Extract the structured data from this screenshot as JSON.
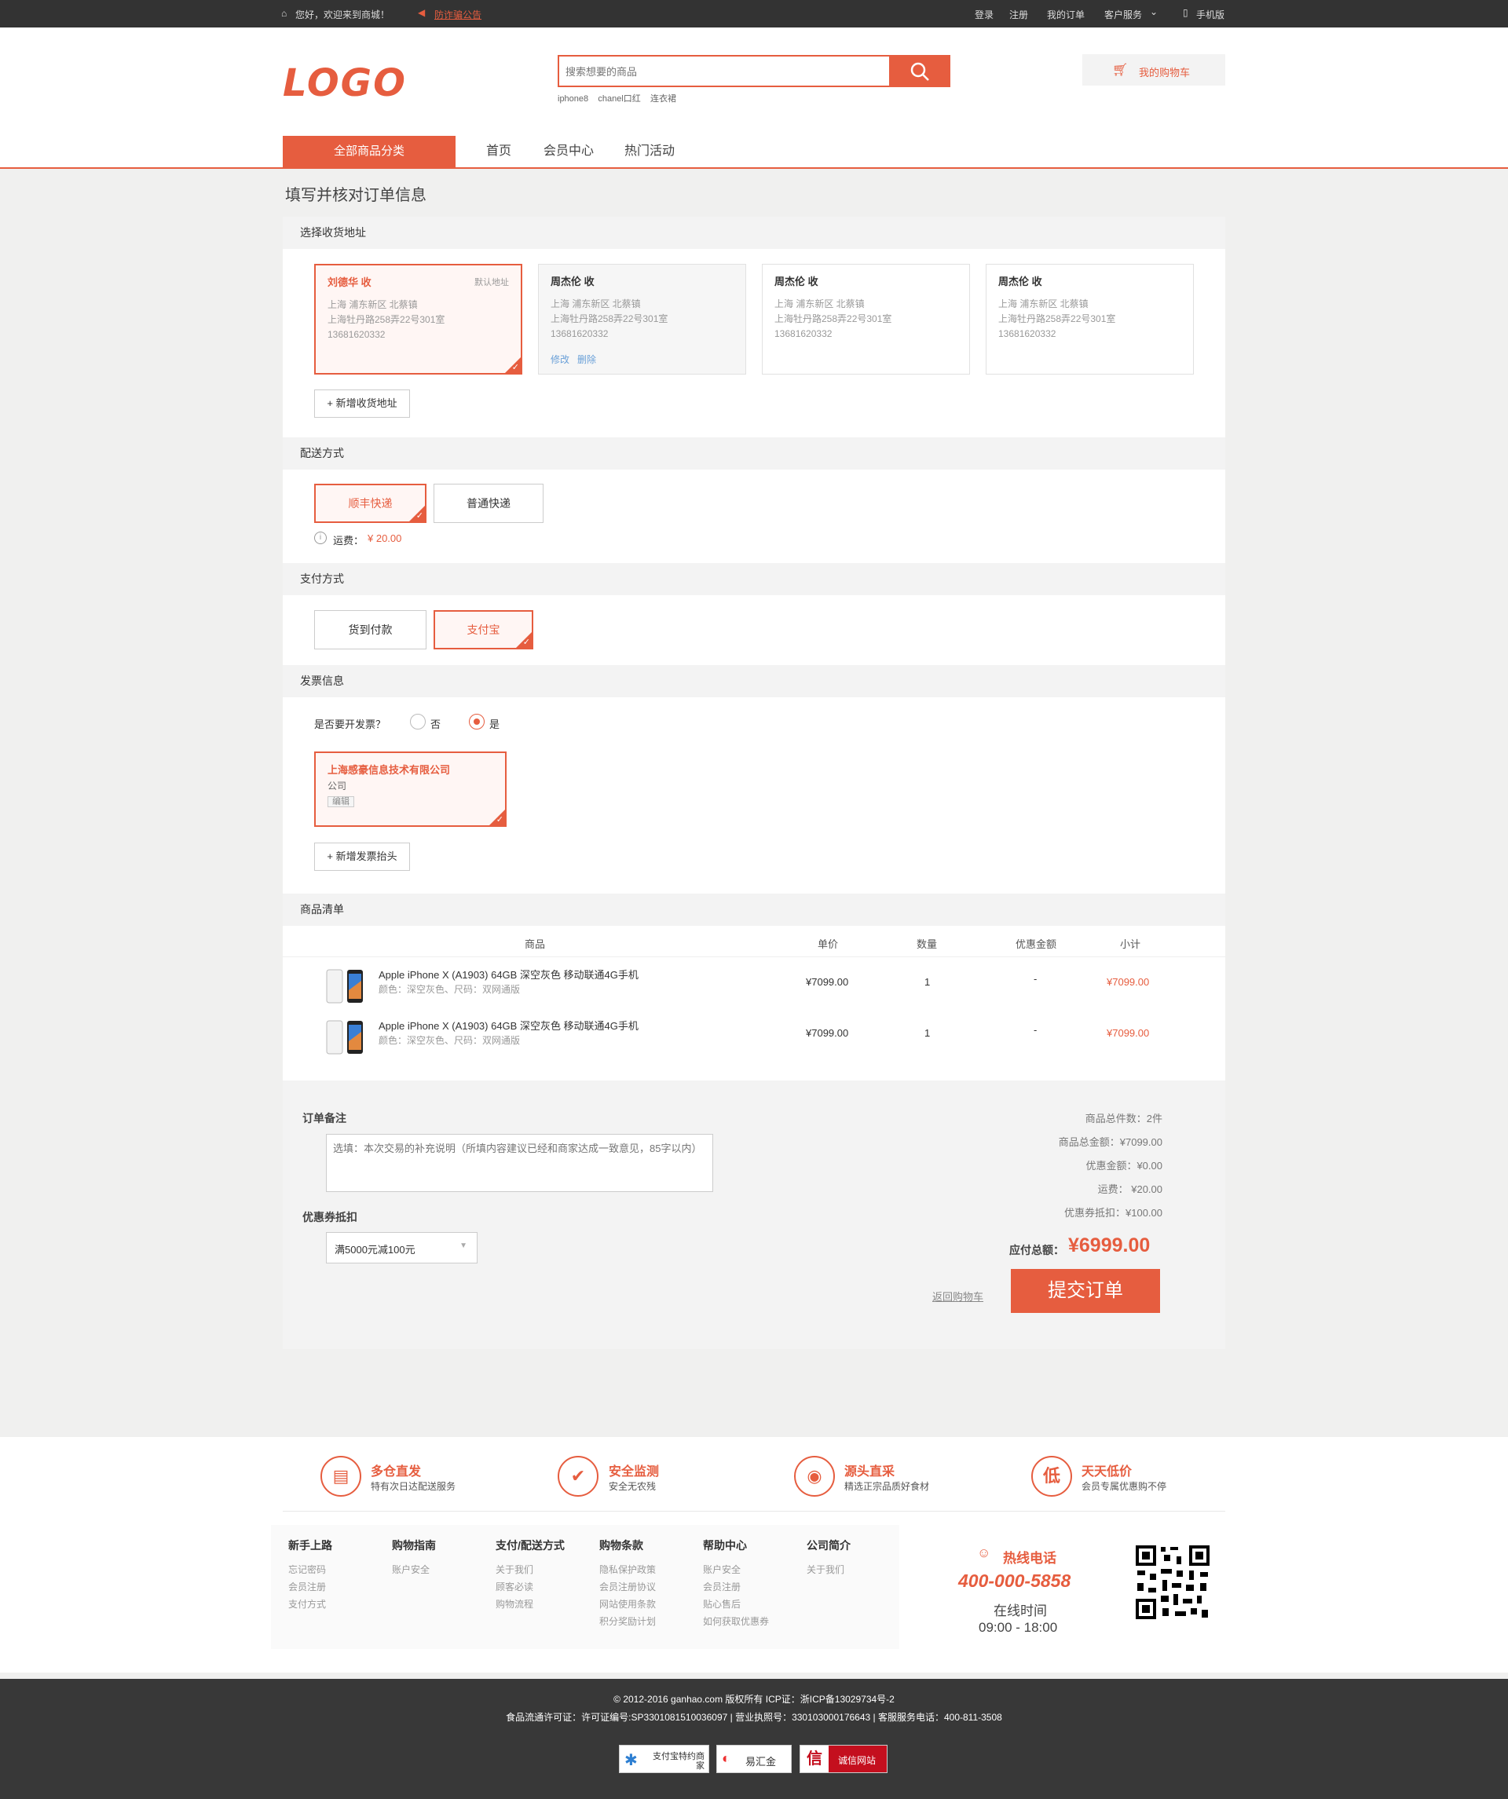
{
  "topbar": {
    "welcome": "您好，欢迎来到商城！",
    "notice": "防诈骗公告",
    "login": "登录",
    "register": "注册",
    "my_orders": "我的订单",
    "service": "客户服务",
    "mobile": "手机版"
  },
  "header": {
    "logo": "LOGO",
    "search_placeholder": "搜索想要的商品",
    "hot": [
      "iphone8",
      "chanel口红",
      "连衣裙"
    ],
    "cart": "我的购物车"
  },
  "nav": {
    "category": "全部商品分类",
    "links": [
      "首页",
      "会员中心",
      "热门活动"
    ]
  },
  "page_title": "填写并核对订单信息",
  "address": {
    "title": "选择收货地址",
    "cards": [
      {
        "name": "刘德华 收",
        "default": "默认地址",
        "line1": "上海 浦东新区 北蔡镇",
        "line2": "上海牡丹路258弄22号301室",
        "phone": "13681620332"
      },
      {
        "name": "周杰伦 收",
        "line1": "上海 浦东新区 北蔡镇",
        "line2": "上海牡丹路258弄22号301室",
        "phone": "13681620332",
        "edit": "修改",
        "delete": "删除"
      },
      {
        "name": "周杰伦 收",
        "line1": "上海 浦东新区 北蔡镇",
        "line2": "上海牡丹路258弄22号301室",
        "phone": "13681620332"
      },
      {
        "name": "周杰伦 收",
        "line1": "上海 浦东新区 北蔡镇",
        "line2": "上海牡丹路258弄22号301室",
        "phone": "13681620332"
      }
    ],
    "add": "+ 新增收货地址"
  },
  "shipping": {
    "title": "配送方式",
    "options": [
      "顺丰快递",
      "普通快递"
    ],
    "fee_label": "运费：",
    "fee": "¥ 20.00"
  },
  "payment": {
    "title": "支付方式",
    "options": [
      "货到付款",
      "支付宝"
    ]
  },
  "invoice": {
    "title": "发票信息",
    "question": "是否要开发票？",
    "no": "否",
    "yes": "是",
    "company": "上海感豪信息技术有限公司",
    "type": "公司",
    "edit": "编辑",
    "add": "+ 新增发票抬头"
  },
  "items": {
    "title": "商品清单",
    "headers": [
      "商品",
      "单价",
      "数量",
      "优惠金额",
      "小计"
    ],
    "rows": [
      {
        "name": "Apple iPhone X (A1903) 64GB 深空灰色 移动联通4G手机",
        "spec": "颜色：深空灰色、尺码：双网通版",
        "price": "¥7099.00",
        "qty": "1",
        "discount": "-",
        "subtotal": "¥7099.00"
      },
      {
        "name": "Apple iPhone X (A1903) 64GB 深空灰色 移动联通4G手机",
        "spec": "颜色：深空灰色、尺码：双网通版",
        "price": "¥7099.00",
        "qty": "1",
        "discount": "-",
        "subtotal": "¥7099.00"
      }
    ]
  },
  "remark": {
    "title": "订单备注",
    "placeholder": "选填：本次交易的补充说明（所填内容建议已经和商家达成一致意见，85字以内）"
  },
  "coupon": {
    "title": "优惠券抵扣",
    "selected": "满5000元减100元"
  },
  "summary": {
    "count": "商品总件数：2件",
    "total": "商品总金额：¥7099.00",
    "discount": "优惠金额：¥0.00",
    "shipping": "运费： ¥20.00",
    "coupon": "优惠券抵扣：¥100.00",
    "payable_label": "应付总额：",
    "payable": "¥6999.00",
    "back": "返回购物车",
    "submit": "提交订单"
  },
  "services": [
    {
      "icon": "warehouse-icon",
      "glyph": "▤",
      "title": "多仓直发",
      "desc": "特有次日达配送服务"
    },
    {
      "icon": "shield-icon",
      "glyph": "✔",
      "title": "安全监测",
      "desc": "安全无农残"
    },
    {
      "icon": "food-icon",
      "glyph": "◉",
      "title": "源头直采",
      "desc": "精选正宗品质好食材"
    },
    {
      "icon": "low-price-icon",
      "glyph": "低",
      "title": "天天低价",
      "desc": "会员专属优惠购不停"
    }
  ],
  "footer_cols": [
    {
      "title": "新手上路",
      "items": [
        "忘记密码",
        "会员注册",
        "支付方式"
      ]
    },
    {
      "title": "购物指南",
      "items": [
        "账户安全"
      ]
    },
    {
      "title": "支付/配送方式",
      "items": [
        "关于我们",
        "顾客必读",
        "购物流程"
      ]
    },
    {
      "title": "购物条款",
      "items": [
        "隐私保护政策",
        "会员注册协议",
        "网站使用条款",
        "积分奖励计划"
      ]
    },
    {
      "title": "帮助中心",
      "items": [
        "账户安全",
        "会员注册",
        "贴心售后",
        "如何获取优惠券"
      ]
    },
    {
      "title": "公司简介",
      "items": [
        "关于我们"
      ]
    }
  ],
  "hotline": {
    "label": "热线电话",
    "number": "400-000-5858",
    "hours_label": "在线时间",
    "hours": "09:00 - 18:00"
  },
  "copyright": {
    "line1": "© 2012-2016 ganhao.com 版权所有 ICP证：浙ICP备13029734号-2",
    "line2": "食品流通许可证：许可证编号:SP3301081510036097 | 营业执照号：330103000176643 | 客服服务电话：400-811-3508",
    "badges": [
      "支付宝特约商家",
      "易汇金",
      "诚信网站"
    ]
  },
  "colors": {
    "accent": "#e65d3f",
    "dark": "#333333"
  }
}
